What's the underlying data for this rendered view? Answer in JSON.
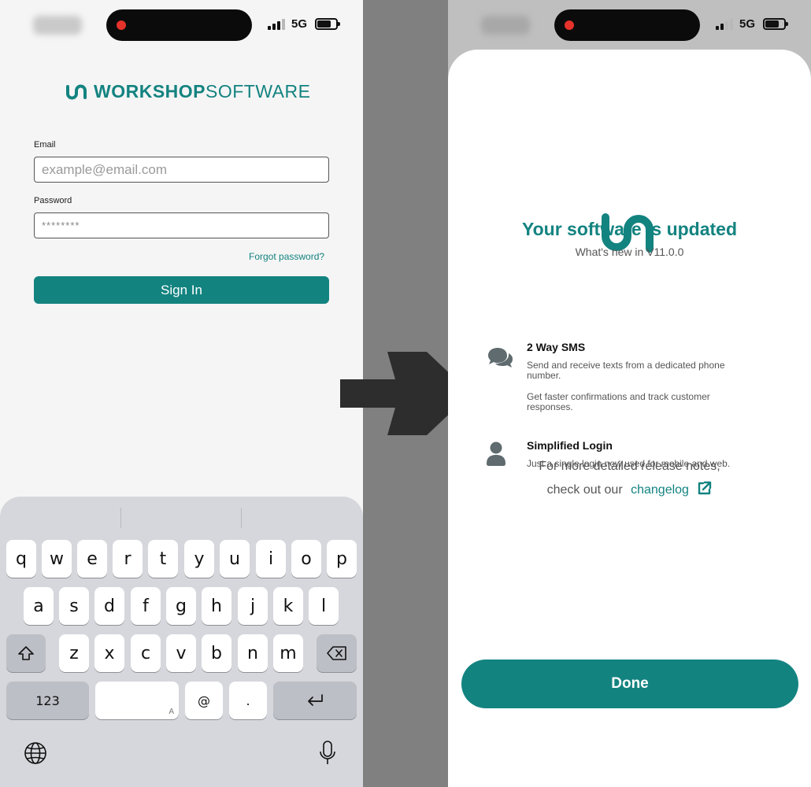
{
  "login": {
    "logo_bold": "WORKSHOP",
    "logo_light": "SOFTWARE",
    "email_label": "Email",
    "email_placeholder": "example@email.com",
    "password_label": "Password",
    "password_value": "********",
    "forgot_password": "Forgot password?",
    "sign_in": "Sign In"
  },
  "status_bar": {
    "network": "5G"
  },
  "keyboard": {
    "row1": [
      "q",
      "w",
      "e",
      "r",
      "t",
      "y",
      "u",
      "i",
      "o",
      "p"
    ],
    "row2": [
      "a",
      "s",
      "d",
      "f",
      "g",
      "h",
      "j",
      "k",
      "l"
    ],
    "row3": [
      "z",
      "x",
      "c",
      "v",
      "b",
      "n",
      "m"
    ],
    "numbers_key": "123",
    "at_key": "@",
    "dot_key": ".",
    "space_hint": "A"
  },
  "update": {
    "title": "Your software is updated",
    "subtitle": "What's new in V11.0.0",
    "features": [
      {
        "icon": "chat-bubbles-icon",
        "title": "2 Way SMS",
        "desc1": "Send and receive texts from a dedicated phone number.",
        "desc2": "Get faster confirmations and track customer responses."
      },
      {
        "icon": "user-icon",
        "title": "Simplified Login",
        "desc1": "Just a single login now used for mobile and web."
      }
    ],
    "more_line1": "For more detailed release notes,",
    "more_line2": "check out our",
    "changelog": "changelog",
    "done": "Done"
  },
  "colors": {
    "brand": "#138380"
  }
}
